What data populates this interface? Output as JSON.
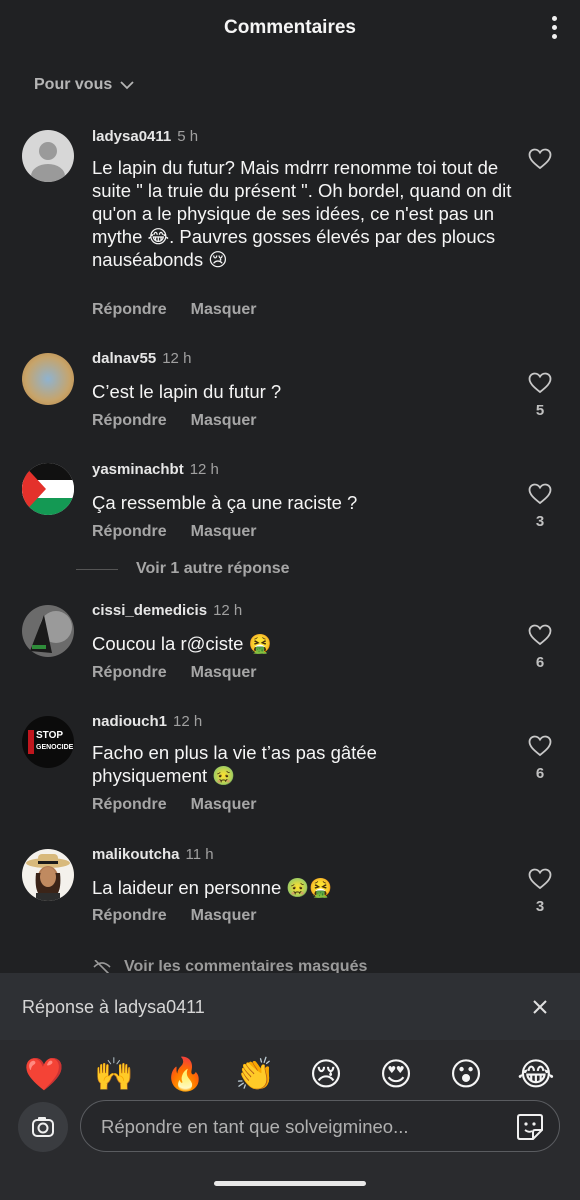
{
  "header": {
    "title": "Commentaires",
    "more_icon": "more-vertical-icon"
  },
  "sort": {
    "label": "Pour vous",
    "icon": "chevron-down-icon"
  },
  "comments": [
    {
      "user": "ladysa0411",
      "time": "5 h",
      "text": "Le lapin du futur? Mais mdrrr renomme toi tout de suite \" la truie du présent \". Oh bordel, quand on dit qu'on a le physique de ses idées, ce n'est pas un mythe 😂. Pauvres gosses élevés par des ploucs nauséabonds 😢",
      "reply": "Répondre",
      "hide": "Masquer",
      "likes": "",
      "avatar": "default-avatar"
    },
    {
      "user": "dalnav55",
      "time": "12 h",
      "text": "C’est le lapin du futur ?",
      "reply": "Répondre",
      "hide": "Masquer",
      "likes": "5",
      "avatar": "photo-avatar"
    },
    {
      "user": "yasminachbt",
      "time": "12 h",
      "text": "Ça ressemble à ça une raciste ?",
      "reply": "Répondre",
      "hide": "Masquer",
      "likes": "3",
      "avatar": "flag-avatar"
    },
    {
      "user": "cissi_demedicis",
      "time": "12 h",
      "text": "Coucou la r@ciste 🤮",
      "reply": "Répondre",
      "hide": "Masquer",
      "likes": "6",
      "avatar": "photo-avatar"
    },
    {
      "user": "nadiouch1",
      "time": "12 h",
      "text": "Facho en plus la vie t’as pas gâtée physiquement 🤢",
      "reply": "Répondre",
      "hide": "Masquer",
      "likes": "6",
      "avatar": "stop-genocide-avatar"
    },
    {
      "user": "malikoutcha",
      "time": "11 h",
      "text": "La laideur en personne 🤢🤮",
      "reply": "Répondre",
      "hide": "Masquer",
      "likes": "3",
      "avatar": "cartoon-avatar"
    }
  ],
  "stop_avatar_text": {
    "line1": "STOP",
    "line2": "GENOCIDE"
  },
  "more_replies": "Voir 1 autre réponse",
  "hidden_comments": "Voir les commentaires masqués",
  "reply_bar": {
    "label": "Réponse à ladysa0411",
    "close_icon": "close-icon"
  },
  "emojis": [
    "❤️",
    "🙌",
    "🔥",
    "👏",
    "😢",
    "😍",
    "😮",
    "😂"
  ],
  "input": {
    "placeholder": "Répondre en tant que solveigmineo...",
    "camera_icon": "camera-icon",
    "sticker_icon": "sticker-icon"
  },
  "colors": {
    "background": "#202123",
    "bar": "#2e3034",
    "muted": "#a6a6a6"
  }
}
